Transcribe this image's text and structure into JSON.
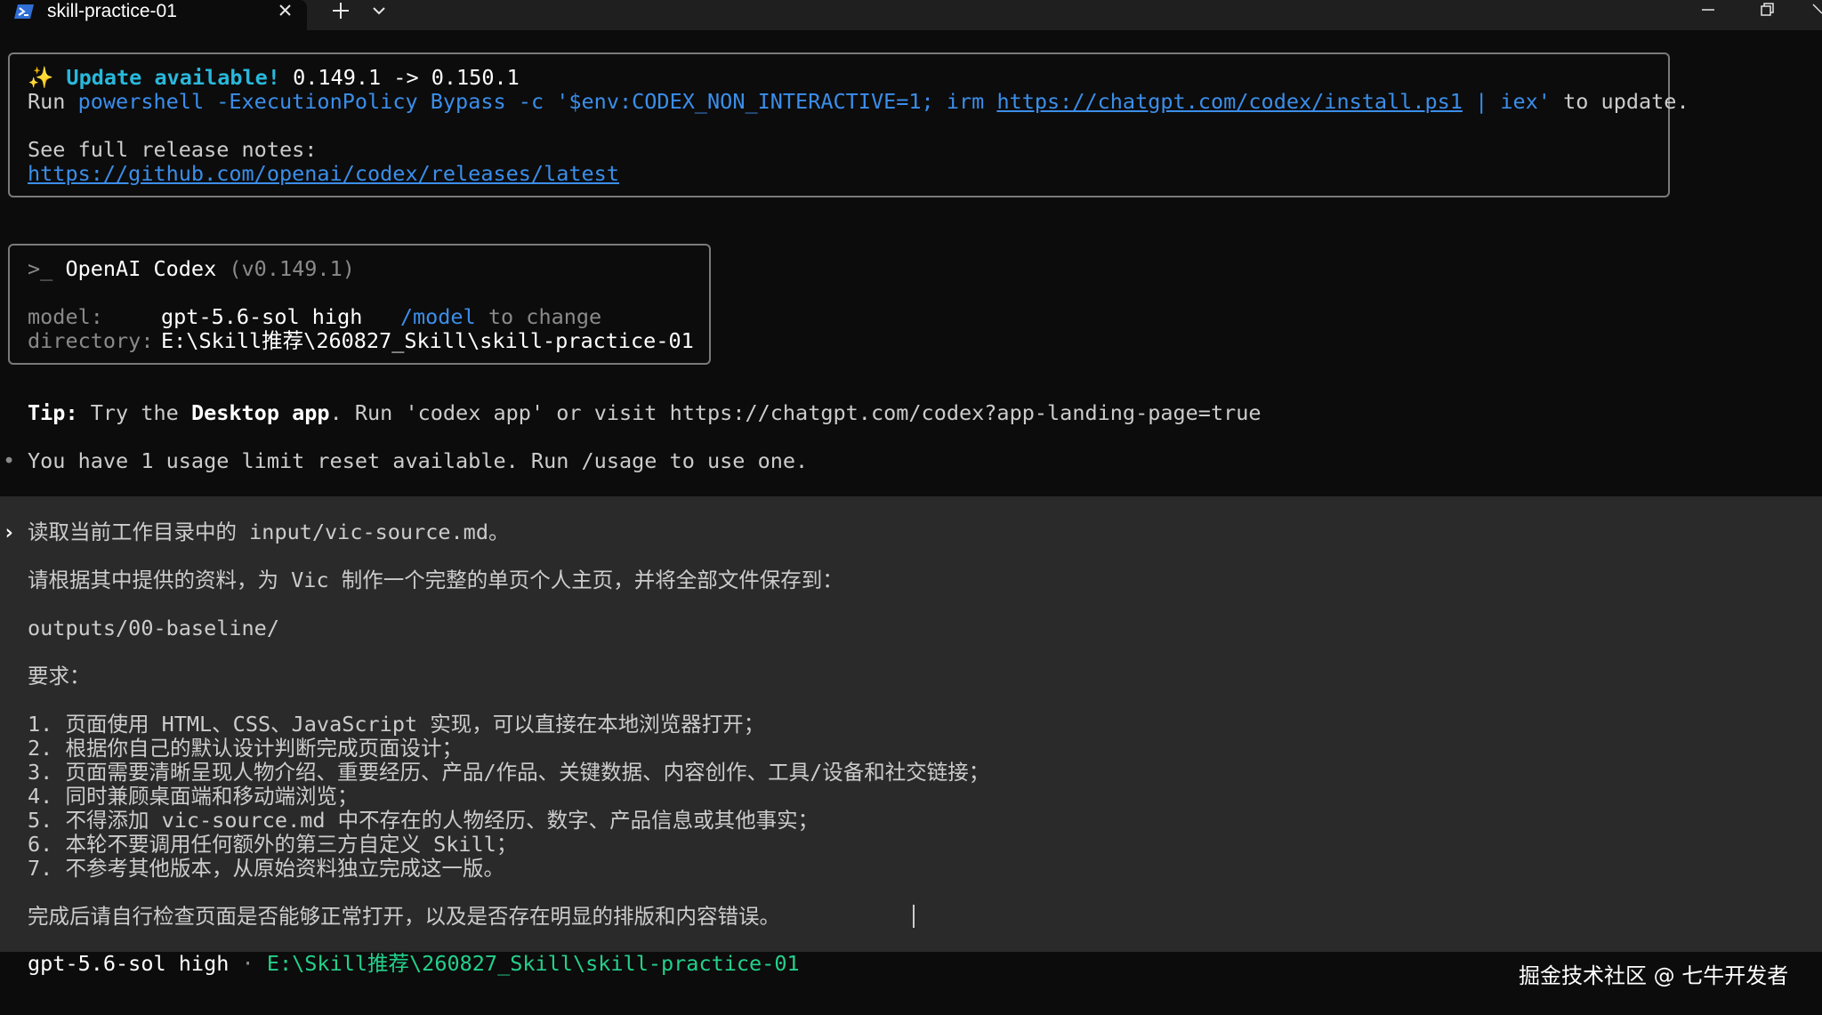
{
  "tab": {
    "title": "skill-practice-01",
    "icon": "powershell-icon"
  },
  "window_controls": [
    "minimize-icon",
    "restore-icon",
    "close-icon"
  ],
  "update": {
    "sparkle": "✨",
    "headline": "Update available!",
    "version": "0.149.1 -> 0.150.1",
    "run_label": "Run",
    "command_prefix": "powershell -ExecutionPolicy Bypass -c '$env:CODEX_NON_INTERACTIVE=1; irm ",
    "command_url": "https://chatgpt.com/codex/install.ps1",
    "command_suffix": " | iex'",
    "to_update": " to update.",
    "notes_label": "See full release notes:",
    "notes_url": "https://github.com/openai/codex/releases/latest"
  },
  "session": {
    "prompt_glyph": ">_",
    "app_name": "OpenAI Codex",
    "version": "(v0.149.1)",
    "model_label": "model:",
    "model_value": "gpt-5.6-sol high",
    "model_hint_cmd": "/model",
    "model_hint_text": " to change",
    "directory_label": "directory:",
    "directory_value": "E:\\Skill推荐\\260827_Skill\\skill-practice-01"
  },
  "tip": {
    "label": "Tip:",
    "pre": " Try the ",
    "bold": "Desktop app",
    "post": ". Run 'codex app' or visit https://chatgpt.com/codex?app-landing-page=true"
  },
  "notice": {
    "bullet": "•",
    "text": "You have 1 usage limit reset available. Run /usage to use one."
  },
  "prompt": {
    "marker": "›",
    "lines": [
      "读取当前工作目录中的 input/vic-source.md。",
      "",
      "请根据其中提供的资料，为 Vic 制作一个完整的单页个人主页，并将全部文件保存到：",
      "",
      "outputs/00-baseline/",
      "",
      "要求：",
      "",
      "1. 页面使用 HTML、CSS、JavaScript 实现，可以直接在本地浏览器打开；",
      "2. 根据你自己的默认设计判断完成页面设计；",
      "3. 页面需要清晰呈现人物介绍、重要经历、产品/作品、关键数据、内容创作、工具/设备和社交链接；",
      "4. 同时兼顾桌面端和移动端浏览；",
      "5. 不得添加 vic-source.md 中不存在的人物经历、数字、产品信息或其他事实；",
      "6. 本轮不要调用任何额外的第三方自定义 Skill；",
      "7. 不参考其他版本，从原始资料独立完成这一版。",
      "",
      "完成后请自行检查页面是否能够正常打开，以及是否存在明显的排版和内容错误。"
    ]
  },
  "status": {
    "model": "gpt-5.6-sol high",
    "separator": "·",
    "directory": "E:\\Skill推荐\\260827_Skill\\skill-practice-01"
  },
  "watermark": "掘金技术社区 @ 七牛开发者"
}
